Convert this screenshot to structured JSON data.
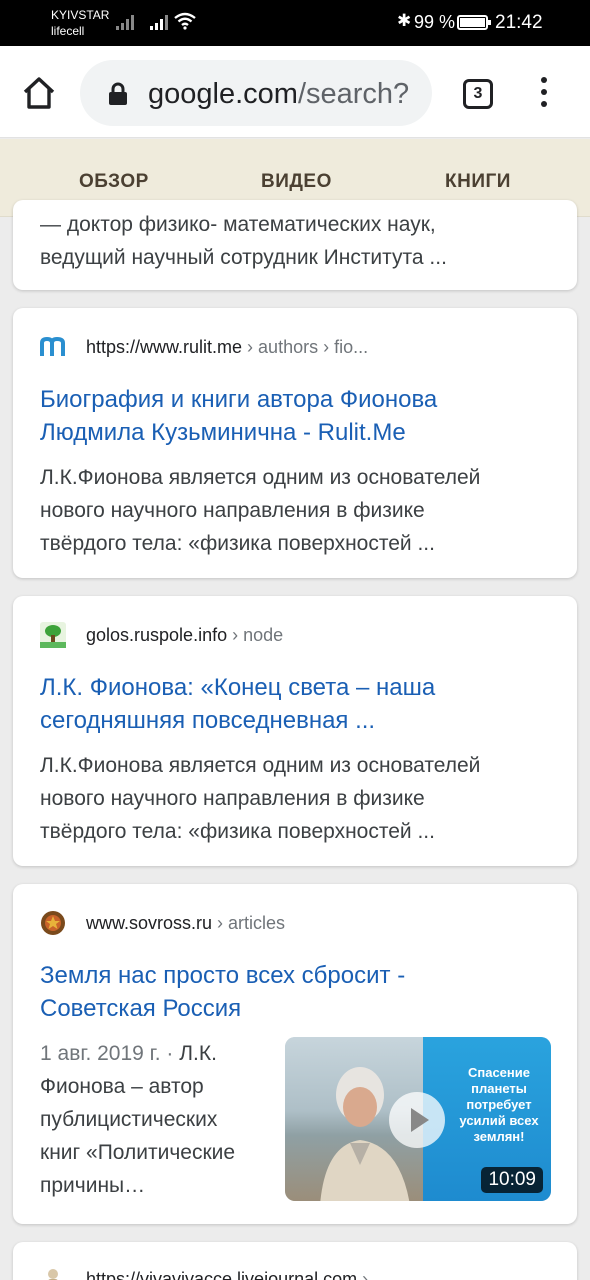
{
  "status_bar": {
    "carrier_1": "KYIVSTAR",
    "carrier_2": "lifecell",
    "battery_percent": "99 %",
    "time": "21:42"
  },
  "browser": {
    "url_host": "google.com",
    "url_path": "/search?",
    "tab_count": "3"
  },
  "search_tabs": {
    "items": [
      {
        "label": "ОБЗОР",
        "active": true
      },
      {
        "label": "ВИДЕО",
        "active": false
      },
      {
        "label": "КНИГИ",
        "active": false
      }
    ]
  },
  "results": [
    {
      "snippet_lines": [
        "— доктор физико- математических наук,",
        "ведущий научный сотрудник Института ..."
      ]
    },
    {
      "favicon": "rulit-m-icon",
      "site_url": "https://www.rulit.me",
      "breadcrumb": " › authors › fio...",
      "title_lines": [
        "Биография и книги автора Фионова",
        "Людмила Кузьминична - Rulit.Me"
      ],
      "snippet_lines": [
        "Л.К.Фионова является одним из основателей",
        "нового научного направления в физике",
        "твёрдого тела: «физика поверхностей ..."
      ]
    },
    {
      "favicon": "tree-icon",
      "site_url": "golos.ruspole.info",
      "breadcrumb": " › node",
      "title_lines": [
        "Л.К. Фионова: «Конец света – наша",
        "сегодняшняя повседневная ..."
      ],
      "snippet_lines": [
        "Л.К.Фионова является одним из основателей",
        "нового научного направления в физике",
        "твёрдого тела: «физика поверхностей ..."
      ]
    },
    {
      "favicon": "emblem-icon",
      "site_url": "www.sovross.ru",
      "breadcrumb": " › articles",
      "title_lines": [
        "Земля нас просто всех сбросит -",
        "Советская Россия"
      ],
      "date": "1 авг. 2019 г. · ",
      "snippet_lines": [
        "Л.К.",
        "Фионова – автор",
        "публицистических",
        "книг «Политические",
        "причины…"
      ],
      "video": {
        "banner_text": "Спасение планеты потребует усилий всех землян!",
        "duration": "10:09"
      }
    },
    {
      "favicon": "person-icon",
      "site_url": "https://vivavivacce.livejournal.com",
      "breadcrumb": " ›"
    }
  ]
}
